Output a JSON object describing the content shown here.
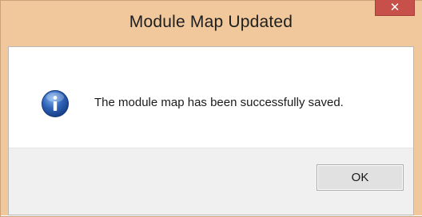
{
  "dialog": {
    "title": "Module Map Updated",
    "message": "The module map has been successfully saved.",
    "icon": "info-icon",
    "close_icon": "close-icon",
    "ok_label": "OK"
  },
  "colors": {
    "frame": "#f0c89c",
    "close_button": "#c7504a",
    "footer": "#f0f0f0",
    "info_icon": "#2e63b8"
  }
}
